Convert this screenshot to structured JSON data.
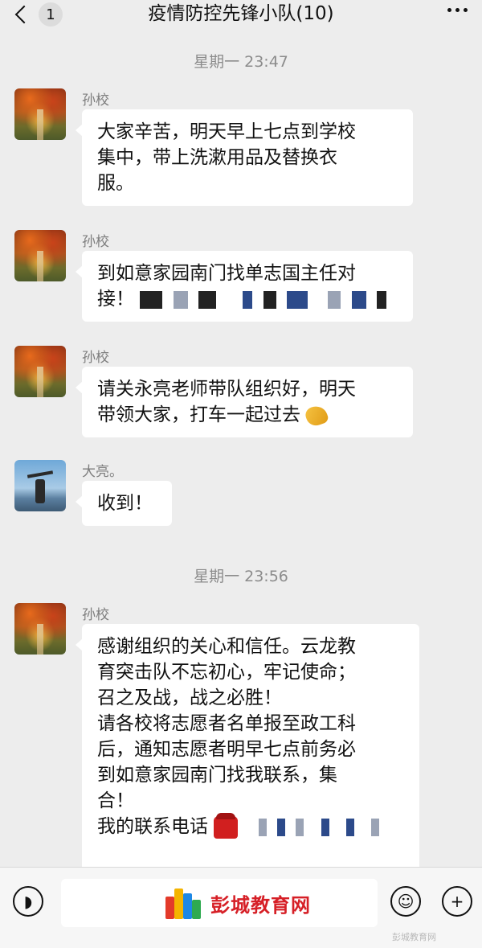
{
  "header": {
    "unread_count": "1",
    "title": "疫情防控先锋小队(10)"
  },
  "timestamps": [
    "星期一 23:47",
    "星期一 23:56"
  ],
  "messages": [
    {
      "sender": "孙校",
      "avatar": "autumn-forest-photo",
      "lines": [
        "大家辛苦，明天早上七点到学校",
        "集中，带上洗漱用品及替换衣",
        "服。"
      ]
    },
    {
      "sender": "孙校",
      "avatar": "autumn-forest-photo",
      "lines": [
        "到如意家园南门找单志国主任对",
        "接！"
      ]
    },
    {
      "sender": "孙校",
      "avatar": "autumn-forest-photo",
      "lines": [
        "请关永亮老师带队组织好，明天",
        "带领大家，打车一起过去"
      ]
    },
    {
      "sender": "大亮。",
      "avatar": "person-lake-photo",
      "lines": [
        "收到！"
      ]
    },
    {
      "sender": "孙校",
      "avatar": "autumn-forest-photo",
      "lines": [
        "感谢组织的关心和信任。云龙教",
        "育突击队不忘初心，牢记使命；",
        "召之及战，战之必胜！",
        "请各校将志愿者名单报至政工科",
        "后，通知志愿者明早七点前务必",
        "到如意家园南门找我联系，集",
        "合！",
        "我的联系电话"
      ]
    }
  ],
  "input_bar": {
    "watermark_text": "彭城教育网",
    "watermark_small": "彭城教育网"
  },
  "icons": {
    "back": "chevron-left-icon",
    "more": "more-dots-icon",
    "voice": "voice-icon",
    "emoji": "emoji-icon",
    "plus": "plus-icon"
  }
}
